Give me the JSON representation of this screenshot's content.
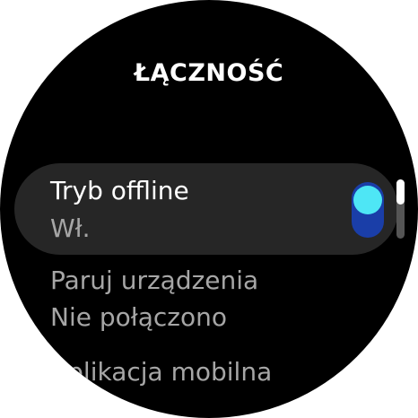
{
  "header": {
    "title": "ŁĄCZNOŚĆ"
  },
  "settings": {
    "offline_mode": {
      "label": "Tryb offline",
      "status": "Wł.",
      "toggle_on": true
    },
    "pair_devices": {
      "label": "Paruj urządzenia",
      "status": "Nie połączono"
    },
    "mobile_app": {
      "label": "Aplikacja mobilna"
    }
  },
  "colors": {
    "toggle_track": "#1a3ea8",
    "toggle_knob": "#4ee6f5",
    "card_bg": "#262626"
  }
}
